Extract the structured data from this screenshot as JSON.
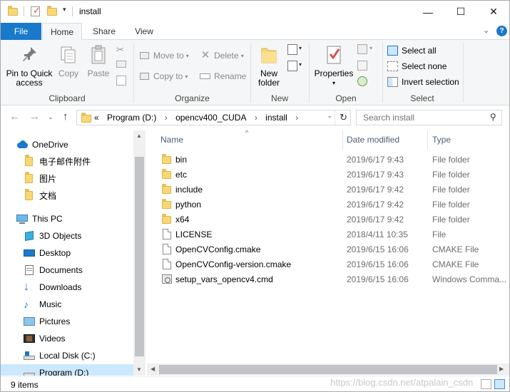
{
  "window": {
    "title": "install",
    "controls": {
      "minimize": "—",
      "maximize": "☐",
      "close": "✕"
    }
  },
  "ribbon_tabs": {
    "file": "File",
    "home": "Home",
    "share": "Share",
    "view": "View"
  },
  "ribbon": {
    "clipboard": {
      "label": "Clipboard",
      "pin_line1": "Pin to Quick",
      "pin_line2": "access",
      "copy": "Copy",
      "paste": "Paste"
    },
    "organize": {
      "label": "Organize",
      "move_to": "Move to",
      "copy_to": "Copy to",
      "delete": "Delete",
      "rename": "Rename"
    },
    "new": {
      "label": "New",
      "new_folder_line1": "New",
      "new_folder_line2": "folder"
    },
    "open": {
      "label": "Open",
      "properties": "Properties"
    },
    "select": {
      "label": "Select",
      "select_all": "Select all",
      "select_none": "Select none",
      "invert_selection": "Invert selection"
    }
  },
  "address_bar": {
    "prefix": "«",
    "crumbs": [
      "Program (D:)",
      "opencv400_CUDA",
      "install"
    ],
    "separator": "›"
  },
  "search": {
    "placeholder": "Search install"
  },
  "navigation": [
    {
      "label": "OneDrive",
      "icon": "cloud-icon"
    },
    {
      "label": "电子邮件附件",
      "icon": "folder-icon"
    },
    {
      "label": "图片",
      "icon": "folder-icon"
    },
    {
      "label": "文档",
      "icon": "folder-icon"
    },
    {
      "label": "This PC",
      "icon": "computer-icon"
    },
    {
      "label": "3D Objects",
      "icon": "cube-icon"
    },
    {
      "label": "Desktop",
      "icon": "desktop-icon"
    },
    {
      "label": "Documents",
      "icon": "documents-icon"
    },
    {
      "label": "Downloads",
      "icon": "download-icon"
    },
    {
      "label": "Music",
      "icon": "music-icon"
    },
    {
      "label": "Pictures",
      "icon": "pictures-icon"
    },
    {
      "label": "Videos",
      "icon": "videos-icon"
    },
    {
      "label": "Local Disk (C:)",
      "icon": "drive-icon"
    },
    {
      "label": "Program (D:)",
      "icon": "drive-icon"
    }
  ],
  "columns": {
    "name": "Name",
    "date_modified": "Date modified",
    "type": "Type"
  },
  "files": [
    {
      "name": "bin",
      "date": "2019/6/17 9:43",
      "type": "File folder",
      "icon": "folder-icon"
    },
    {
      "name": "etc",
      "date": "2019/6/17 9:43",
      "type": "File folder",
      "icon": "folder-icon"
    },
    {
      "name": "include",
      "date": "2019/6/17 9:42",
      "type": "File folder",
      "icon": "folder-icon"
    },
    {
      "name": "python",
      "date": "2019/6/17 9:42",
      "type": "File folder",
      "icon": "folder-icon"
    },
    {
      "name": "x64",
      "date": "2019/6/17 9:42",
      "type": "File folder",
      "icon": "folder-icon"
    },
    {
      "name": "LICENSE",
      "date": "2018/4/11 10:35",
      "type": "File",
      "icon": "file-icon"
    },
    {
      "name": "OpenCVConfig.cmake",
      "date": "2019/6/15 16:06",
      "type": "CMAKE File",
      "icon": "file-icon"
    },
    {
      "name": "OpenCVConfig-version.cmake",
      "date": "2019/6/15 16:06",
      "type": "CMAKE File",
      "icon": "file-icon"
    },
    {
      "name": "setup_vars_opencv4.cmd",
      "date": "2019/6/15 16:06",
      "type": "Windows Comma...",
      "icon": "cmd-file-icon"
    }
  ],
  "status": {
    "item_count": "9 items",
    "watermark": "https://blog.csdn.net/atpalain_csdn"
  },
  "colors": {
    "accent": "#1979ca",
    "selection": "#cce8ff",
    "folder": "#f8d775"
  }
}
